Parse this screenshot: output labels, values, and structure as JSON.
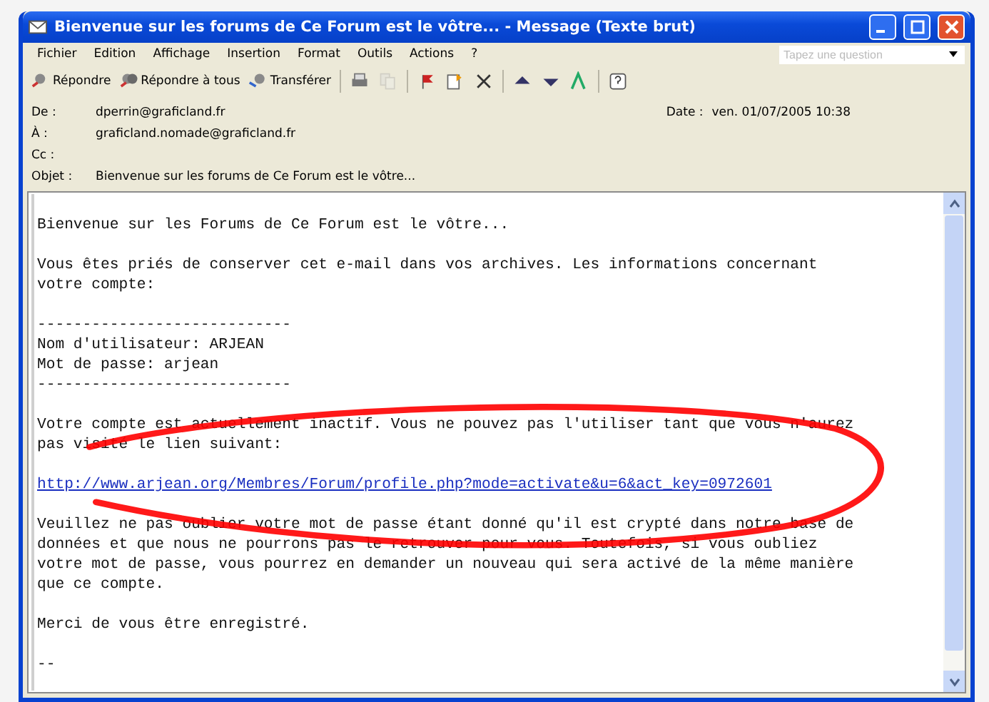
{
  "window": {
    "title": "Bienvenue sur les forums de Ce Forum est le vôtre... - Message (Texte brut)"
  },
  "menu": [
    "Fichier",
    "Edition",
    "Affichage",
    "Insertion",
    "Format",
    "Outils",
    "Actions",
    "?"
  ],
  "help_search": {
    "placeholder": "Tapez une question"
  },
  "toolbar": [
    {
      "kind": "labeled",
      "label": "Répondre"
    },
    {
      "kind": "labeled",
      "label": "Répondre à tous"
    },
    {
      "kind": "labeled",
      "label": "Transférer"
    },
    {
      "kind": "icon"
    },
    {
      "kind": "icon",
      "disabled": true
    },
    {
      "kind": "icon"
    },
    {
      "kind": "icon"
    },
    {
      "kind": "icon"
    },
    {
      "kind": "icon"
    },
    {
      "kind": "icon"
    },
    {
      "kind": "icon"
    },
    {
      "kind": "icon"
    }
  ],
  "header": {
    "fields": [
      {
        "label": "De :",
        "value": "dperrin@graficland.fr"
      },
      {
        "label": "À :",
        "value": "graficland.nomade@graficland.fr"
      },
      {
        "label": "Cc :"
      },
      {
        "label": "Objet :",
        "value": "Bienvenue sur les forums de Ce Forum est le vôtre..."
      }
    ],
    "date": {
      "label": "Date :",
      "value": "ven. 01/07/2005 10:38"
    }
  },
  "body": [
    {
      "kind": "text",
      "text": "Bienvenue sur les Forums de Ce Forum est le vôtre..."
    },
    {
      "kind": "blank"
    },
    {
      "kind": "text",
      "text": "Vous êtes priés de conserver cet e-mail dans vos archives. Les informations concernant\nvotre compte:"
    },
    {
      "kind": "blank"
    },
    {
      "kind": "text",
      "text": "----------------------------\nNom d'utilisateur: ARJEAN\nMot de passe: arjean\n----------------------------"
    },
    {
      "kind": "blank"
    },
    {
      "kind": "text",
      "text": "Votre compte est actuellement inactif. Vous ne pouvez pas l'utiliser tant que vous n'aurez\npas visité le lien suivant:"
    },
    {
      "kind": "blank"
    },
    {
      "kind": "link",
      "text": "http://www.arjean.org/Membres/Forum/profile.php?mode=activate&u=6&act_key=0972601"
    },
    {
      "kind": "blank"
    },
    {
      "kind": "text",
      "text": "Veuillez ne pas oublier votre mot de passe étant donné qu'il est crypté dans notre base de\ndonnées et que nous ne pourrons pas le retrouver pour vous. Toutefois, si vous oubliez\nvotre mot de passe, vous pourrez en demander un nouveau qui sera activé de la même manière\nque ce compte."
    },
    {
      "kind": "blank"
    },
    {
      "kind": "text",
      "text": "Merci de vous être enregistré."
    },
    {
      "kind": "blank"
    },
    {
      "kind": "text",
      "text": "--"
    }
  ]
}
